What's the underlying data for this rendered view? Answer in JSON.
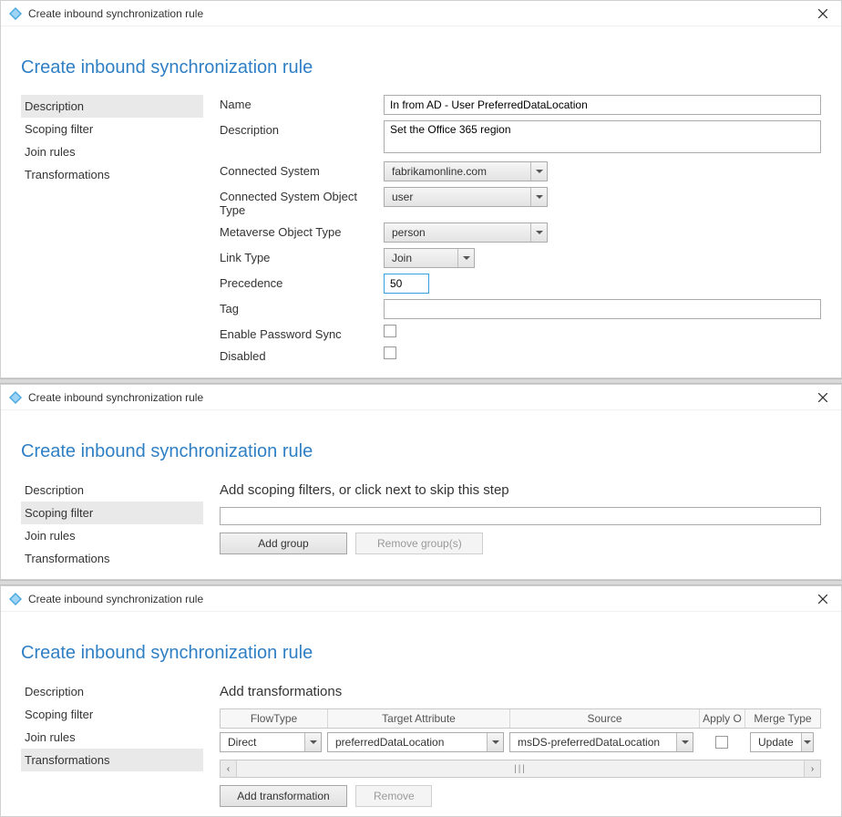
{
  "colors": {
    "accent": "#2f7fc5"
  },
  "icons": {
    "app_icon": "◈"
  },
  "window1": {
    "title": "Create inbound synchronization rule",
    "heading": "Create inbound synchronization rule",
    "sidebar": [
      "Description",
      "Scoping filter",
      "Join rules",
      "Transformations"
    ],
    "active_sidebar_index": 0,
    "labels": {
      "name": "Name",
      "description": "Description",
      "connected_system": "Connected System",
      "cs_object_type": "Connected System Object Type",
      "mv_object_type": "Metaverse Object Type",
      "link_type": "Link Type",
      "precedence": "Precedence",
      "tag": "Tag",
      "enable_password_sync": "Enable Password Sync",
      "disabled": "Disabled"
    },
    "values": {
      "name": "In from AD - User PreferredDataLocation",
      "description": "Set the Office 365 region",
      "connected_system": "fabrikamonline.com",
      "cs_object_type": "user",
      "mv_object_type": "person",
      "link_type": "Join",
      "precedence": "50",
      "tag": ""
    }
  },
  "window2": {
    "title": "Create inbound synchronization rule",
    "heading": "Create inbound synchronization rule",
    "sidebar": [
      "Description",
      "Scoping filter",
      "Join rules",
      "Transformations"
    ],
    "active_sidebar_index": 1,
    "section_title": "Add scoping filters, or click next to skip this step",
    "buttons": {
      "add_group": "Add group",
      "remove_groups": "Remove group(s)"
    }
  },
  "window3": {
    "title": "Create inbound synchronization rule",
    "heading": "Create inbound synchronization rule",
    "sidebar": [
      "Description",
      "Scoping filter",
      "Join rules",
      "Transformations"
    ],
    "active_sidebar_index": 3,
    "section_title": "Add transformations",
    "headers": {
      "flow_type": "FlowType",
      "target_attribute": "Target Attribute",
      "source": "Source",
      "apply_once": "Apply O",
      "merge_type": "Merge Type"
    },
    "row": {
      "flow_type": "Direct",
      "target_attribute": "preferredDataLocation",
      "source": "msDS-preferredDataLocation",
      "merge_type": "Update"
    },
    "buttons": {
      "add_transformation": "Add transformation",
      "remove": "Remove"
    }
  }
}
